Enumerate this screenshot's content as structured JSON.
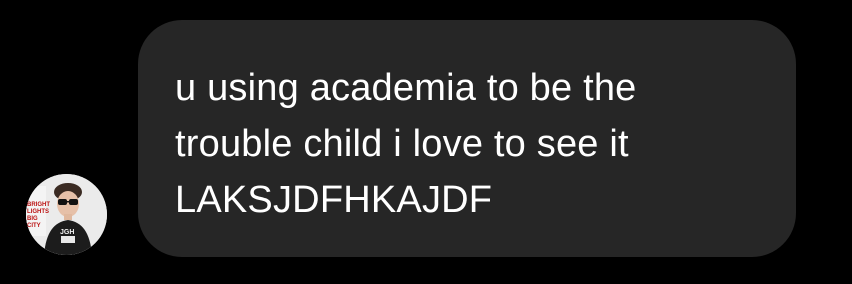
{
  "colors": {
    "background": "#000000",
    "bubble": "#262626",
    "text": "#ffffff"
  },
  "message": {
    "text": "u using academia to be the\ntrouble child i love to see it\nLAKSJDFHKAJDF"
  },
  "avatar": {
    "icon": "user-avatar-photo",
    "poster_text": "BRIGHT LIGHTS BIG CITY",
    "shirt_text": "JGH"
  }
}
